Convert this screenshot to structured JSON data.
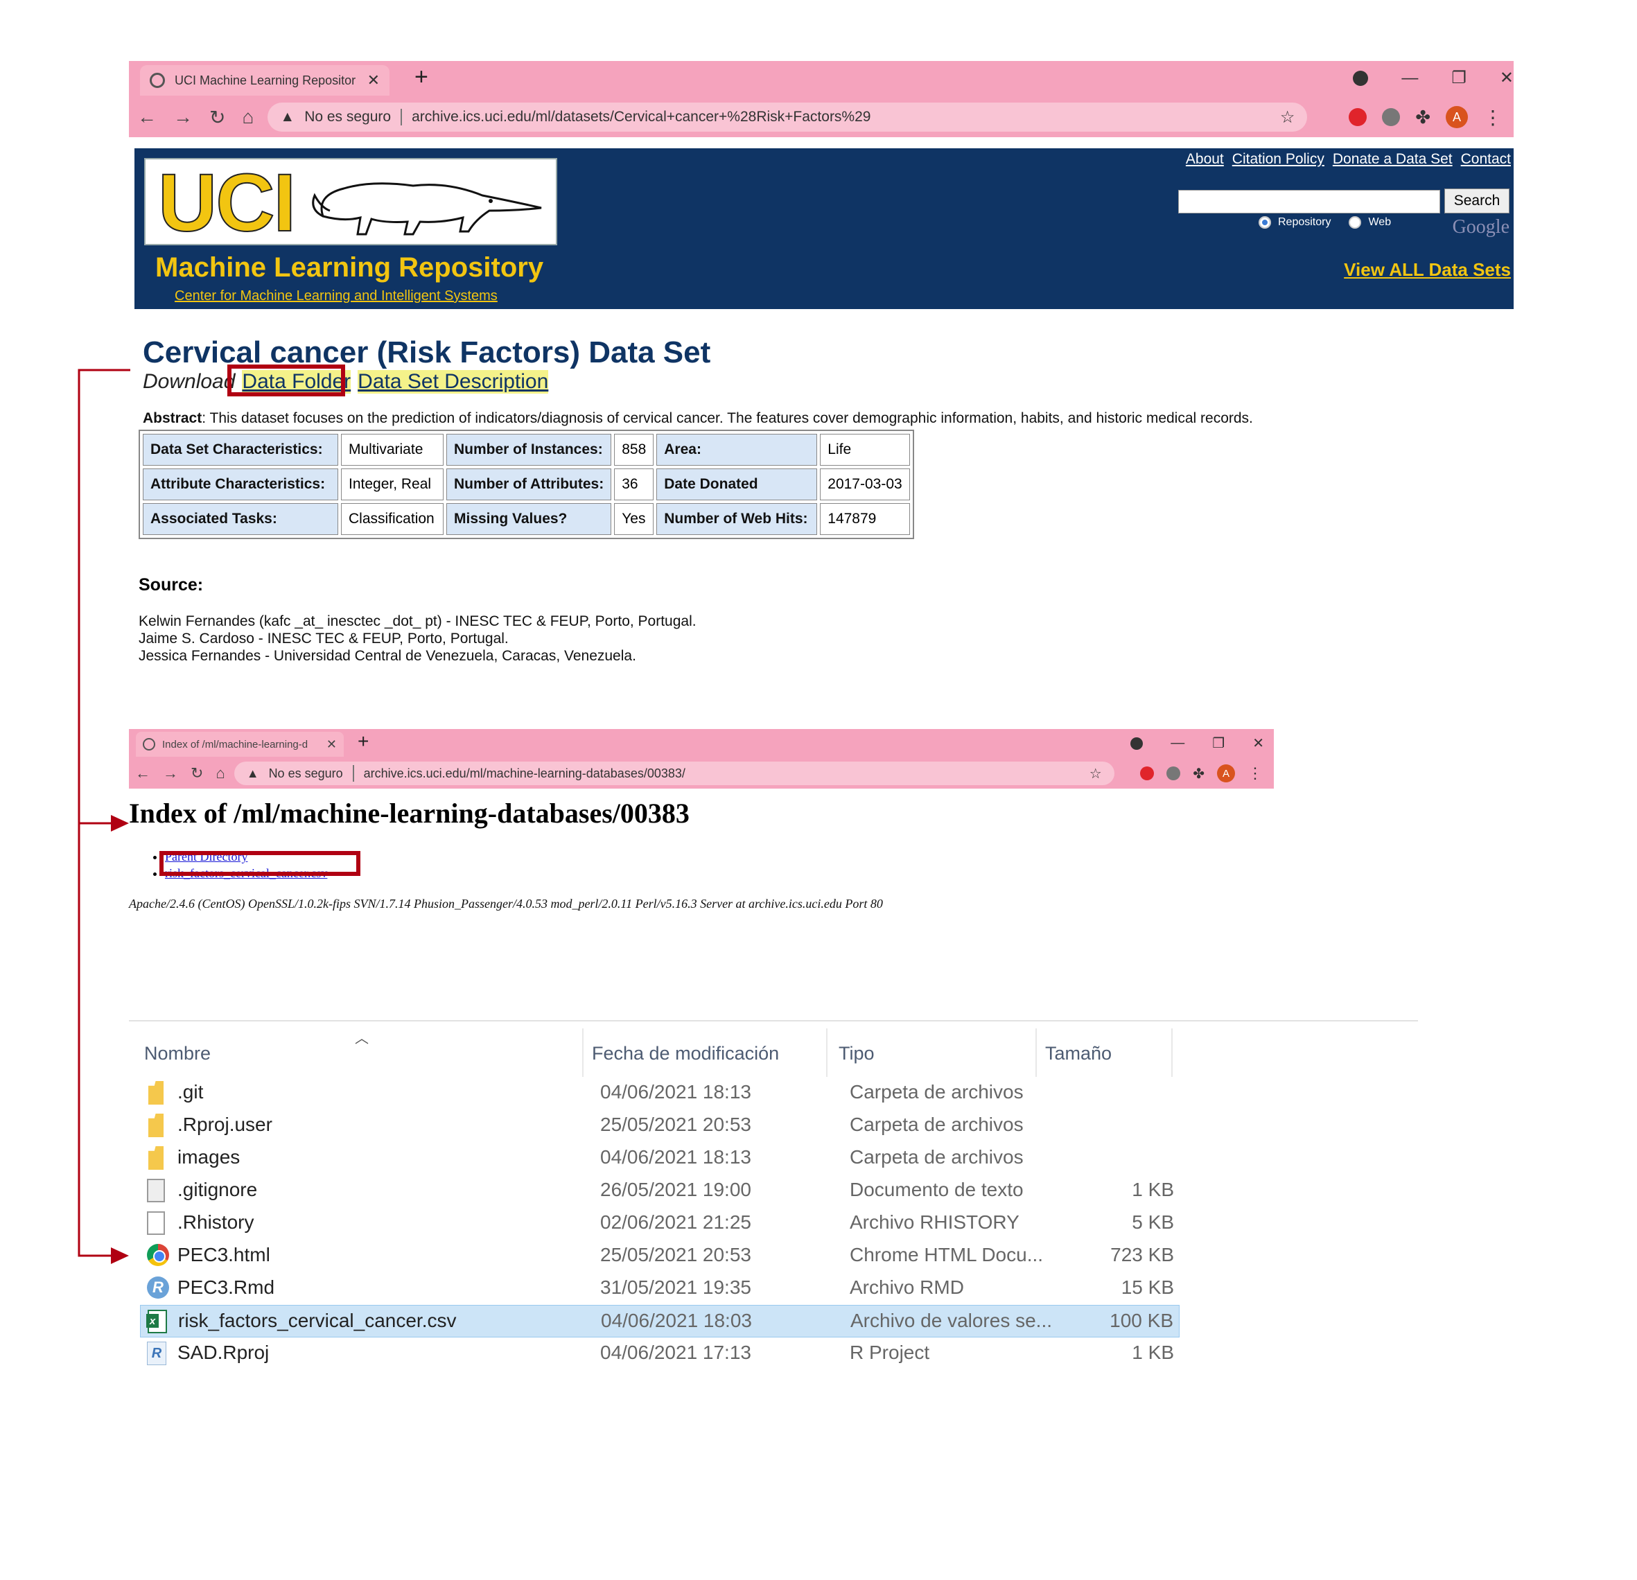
{
  "browser1": {
    "tab_title": "UCI Machine Learning Repositor",
    "security": "No es seguro",
    "url": "archive.ics.uci.edu/ml/datasets/Cervical+cancer+%28Risk+Factors%29",
    "avatar": "A"
  },
  "uci": {
    "logo_text": "UCI",
    "repo_title": "Machine Learning Repository",
    "center_link": "Center for Machine Learning and Intelligent Systems",
    "top_links": [
      "About",
      "Citation Policy",
      "Donate a Data Set",
      "Contact"
    ],
    "search_button": "Search",
    "radio_repository": "Repository",
    "radio_web": "Web",
    "google_label": "Google",
    "view_all": "View ALL Data Sets"
  },
  "dataset": {
    "title": "Cervical cancer (Risk Factors) Data Set",
    "download_label": "Download",
    "data_folder": "Data Folder",
    "description_link": "Data Set Description",
    "abstract_label": "Abstract",
    "abstract_text": ": This dataset focuses on the prediction of indicators/diagnosis of cervical cancer. The features cover demographic information, habits, and historic medical records.",
    "table": [
      [
        "Data Set Characteristics:",
        "Multivariate",
        "Number of Instances:",
        "858",
        "Area:",
        "Life"
      ],
      [
        "Attribute Characteristics:",
        "Integer, Real",
        "Number of Attributes:",
        "36",
        "Date Donated",
        "2017-03-03"
      ],
      [
        "Associated Tasks:",
        "Classification",
        "Missing Values?",
        "Yes",
        "Number of Web Hits:",
        "147879"
      ]
    ],
    "source_heading": "Source:",
    "source_lines": [
      "Kelwin Fernandes (kafc _at_ inesctec _dot_ pt) - INESC TEC & FEUP, Porto, Portugal.",
      "Jaime S. Cardoso - INESC TEC & FEUP, Porto, Portugal.",
      "Jessica Fernandes - Universidad Central de Venezuela, Caracas, Venezuela."
    ]
  },
  "browser2": {
    "tab_title": "Index of /ml/machine-learning-d",
    "security": "No es seguro",
    "url": "archive.ics.uci.edu/ml/machine-learning-databases/00383/",
    "avatar": "A"
  },
  "index_page": {
    "title": "Index of /ml/machine-learning-databases/00383",
    "links": [
      "Parent Directory",
      "risk_factors_cervical_cancer.csv"
    ],
    "server_line": "Apache/2.4.6 (CentOS) OpenSSL/1.0.2k-fips SVN/1.7.14 Phusion_Passenger/4.0.53 mod_perl/2.0.11 Perl/v5.16.3 Server at archive.ics.uci.edu Port 80"
  },
  "explorer": {
    "columns": [
      "Nombre",
      "Fecha de modificación",
      "Tipo",
      "Tamaño"
    ],
    "files": [
      {
        "name": ".git",
        "date": "04/06/2021 18:13",
        "type": "Carpeta de archivos",
        "size": "",
        "icon": "folder-icon"
      },
      {
        "name": ".Rproj.user",
        "date": "25/05/2021 20:53",
        "type": "Carpeta de archivos",
        "size": "",
        "icon": "folder-icon"
      },
      {
        "name": "images",
        "date": "04/06/2021 18:13",
        "type": "Carpeta de archivos",
        "size": "",
        "icon": "folder-icon"
      },
      {
        "name": ".gitignore",
        "date": "26/05/2021 19:00",
        "type": "Documento de texto",
        "size": "1 KB",
        "icon": "text-file-icon"
      },
      {
        "name": ".Rhistory",
        "date": "02/06/2021 21:25",
        "type": "Archivo RHISTORY",
        "size": "5 KB",
        "icon": "blank-file-icon"
      },
      {
        "name": "PEC3.html",
        "date": "25/05/2021 20:53",
        "type": "Chrome HTML Docu...",
        "size": "723 KB",
        "icon": "chrome-icon"
      },
      {
        "name": "PEC3.Rmd",
        "date": "31/05/2021 19:35",
        "type": "Archivo RMD",
        "size": "15 KB",
        "icon": "r-icon"
      },
      {
        "name": "risk_factors_cervical_cancer.csv",
        "date": "04/06/2021 18:03",
        "type": "Archivo de valores se...",
        "size": "100 KB",
        "icon": "excel-csv-icon",
        "selected": true
      },
      {
        "name": "SAD.Rproj",
        "date": "04/06/2021 17:13",
        "type": "R Project",
        "size": "1 KB",
        "icon": "rproj-icon"
      }
    ]
  },
  "colors": {
    "chrome_theme": "#f5a3bd",
    "uci_navy": "#0f3464",
    "uci_gold": "#f2c511",
    "highlight_red": "#b00012",
    "selection_blue": "#cce4f7"
  }
}
